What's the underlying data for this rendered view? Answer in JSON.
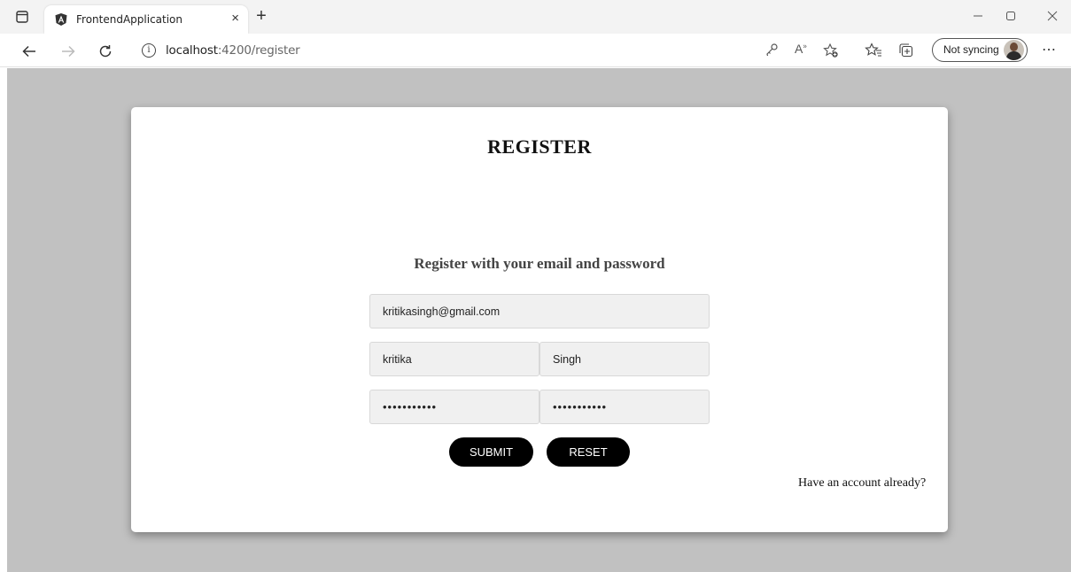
{
  "browser": {
    "tab_title": "FrontendApplication",
    "tab_close": "×",
    "new_tab": "+",
    "url_host": "localhost",
    "url_path": ":4200/register",
    "sync_label": "Not syncing",
    "icons": {
      "tab_actions": "tab-actions-icon",
      "favicon": "angular-icon",
      "back": "back-arrow-icon",
      "forward": "forward-arrow-icon",
      "refresh": "refresh-icon",
      "site_info": "info-icon",
      "key": "key-icon",
      "read_aloud": "read-aloud-icon",
      "add_favorite": "add-favorite-icon",
      "favorites": "favorites-icon",
      "collections": "collections-icon",
      "more": "more-icon",
      "minimize": "minimize-icon",
      "restore": "restore-icon",
      "close": "close-icon"
    }
  },
  "page": {
    "background": "#c1c1c1",
    "title": "REGISTER",
    "subtitle": "Register with your email and password",
    "form": {
      "email": "kritikasingh@gmail.com",
      "first_name": "kritika",
      "last_name": "Singh",
      "password": "•••••••••••",
      "confirm_password": "•••••••••••"
    },
    "buttons": {
      "submit": "SUBMIT",
      "reset": "RESET"
    },
    "login_link": "Have an account already?"
  }
}
